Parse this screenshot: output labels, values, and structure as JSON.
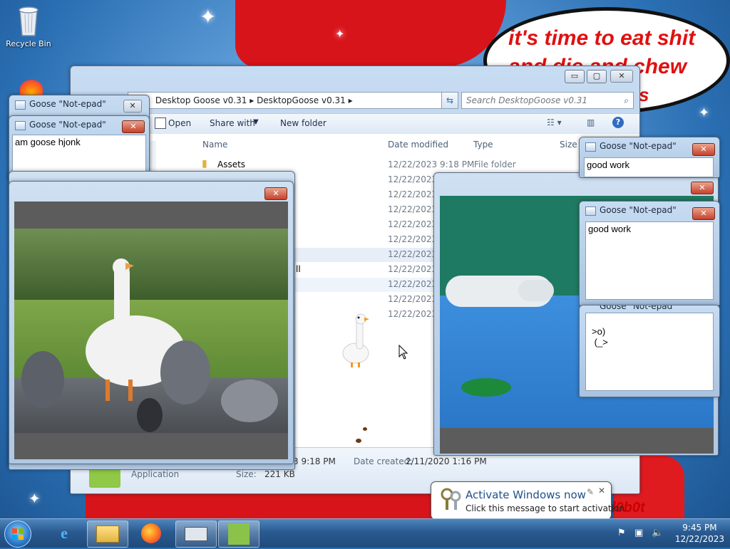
{
  "desktop": {
    "recycle_bin_label": "Recycle Bin",
    "wallpaper_bubble_lines": [
      "it's time to eat shit",
      "and die and chew",
      "s"
    ],
    "wallpaper_signature": "l0b0t"
  },
  "explorer": {
    "breadcrumb": [
      "Desktop Goose v0.31",
      "DesktopGoose v0.31"
    ],
    "search_placeholder": "Search DesktopGoose v0.31",
    "commands": {
      "open": "Open",
      "share_with": "Share with",
      "new_folder": "New folder"
    },
    "columns": {
      "name": "Name",
      "date_modified": "Date modified",
      "type": "Type",
      "size": "Size"
    },
    "rows": [
      {
        "name": "Assets",
        "date": "12/22/2023 9:18 PM",
        "type": "File folder"
      },
      {
        "date": "12/22/2023 9"
      },
      {
        "date": "12/22/2023 9"
      },
      {
        "date": "12/22/2023 9"
      },
      {
        "date": "12/22/2023 9"
      },
      {
        "date": "12/22/2023 9"
      },
      {
        "date": "12/22/2023 9"
      },
      {
        "date": "12/22/2023 9"
      },
      {
        "date": "12/22/2023 9"
      },
      {
        "date": "12/22/2023 9"
      },
      {
        "date": "12/22/2023 9"
      }
    ],
    "partial_row_text": "ll",
    "details": {
      "modified_fragment": "3 9:18 PM",
      "date_created_label": "Date created:",
      "date_created_value": "2/11/2020 1:16 PM",
      "type": "Application",
      "size_label": "Size:",
      "size_value": "221 KB"
    }
  },
  "notepads": [
    {
      "title": "Goose \"Not-epad\"",
      "text": ""
    },
    {
      "title": "Goose \"Not-epad\"",
      "text": "am goose hjonk"
    },
    {
      "title": "Goose \"Not-epad\"",
      "text": "good work"
    },
    {
      "title": "Goose \"Not-epad\"",
      "text": "good work"
    },
    {
      "title": "Goose \"Not-epad\"",
      "text": ">o)\n (_>"
    }
  ],
  "balloon": {
    "title": "Activate Windows now",
    "body": "Click this message to start activation."
  },
  "clock": {
    "time": "9:45 PM",
    "date": "12/22/2023"
  },
  "taskbar": {
    "items": [
      "start-orb",
      "internet-explorer-icon",
      "windows-explorer-icon",
      "firefox-icon",
      "keyboard-app-icon",
      "desktop-goose-icon"
    ]
  },
  "colors": {
    "accent_red": "#d8141b",
    "close_red": "#c7402a",
    "taskbar_blue": "#2a5a90"
  }
}
